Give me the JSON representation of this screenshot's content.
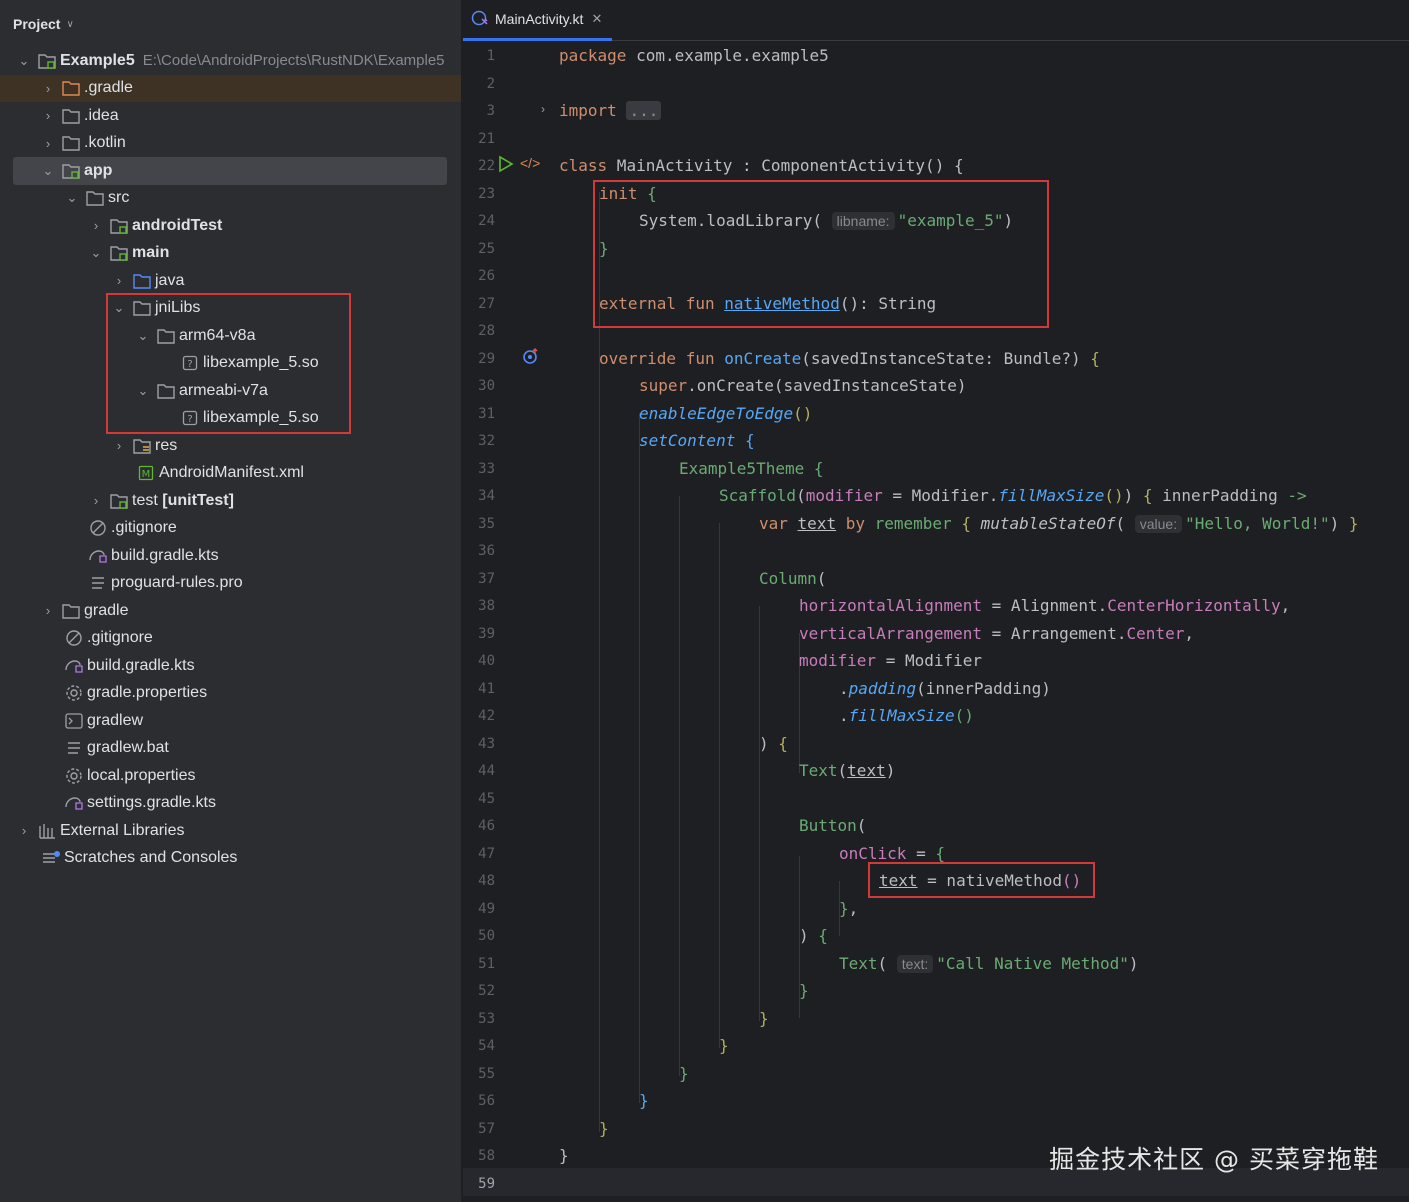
{
  "project_panel": {
    "title": "Project",
    "root": {
      "name": "Example5",
      "path": "E:\\Code\\AndroidProjects\\RustNDK\\Example5"
    },
    "items": [
      {
        "label": ".gradle"
      },
      {
        "label": ".idea"
      },
      {
        "label": ".kotlin"
      },
      {
        "label": "app"
      },
      {
        "label": "src"
      },
      {
        "label": "androidTest"
      },
      {
        "label": "main"
      },
      {
        "label": "java"
      },
      {
        "label": "jniLibs"
      },
      {
        "label": "arm64-v8a"
      },
      {
        "label": "libexample_5.so"
      },
      {
        "label": "armeabi-v7a"
      },
      {
        "label": "libexample_5.so"
      },
      {
        "label": "res"
      },
      {
        "label": "AndroidManifest.xml"
      },
      {
        "label": "test",
        "suffix": "[unitTest]"
      },
      {
        "label": ".gitignore"
      },
      {
        "label": "build.gradle.kts"
      },
      {
        "label": "proguard-rules.pro"
      },
      {
        "label": "gradle"
      },
      {
        "label": ".gitignore"
      },
      {
        "label": "build.gradle.kts"
      },
      {
        "label": "gradle.properties"
      },
      {
        "label": "gradlew"
      },
      {
        "label": "gradlew.bat"
      },
      {
        "label": "local.properties"
      },
      {
        "label": "settings.gradle.kts"
      },
      {
        "label": "External Libraries"
      },
      {
        "label": "Scratches and Consoles"
      }
    ]
  },
  "editor": {
    "tab_label": "MainActivity.kt",
    "line_numbers": [
      "1",
      "2",
      "3",
      "21",
      "22",
      "23",
      "24",
      "25",
      "26",
      "27",
      "28",
      "29",
      "30",
      "31",
      "32",
      "33",
      "34",
      "35",
      "36",
      "37",
      "38",
      "39",
      "40",
      "41",
      "42",
      "43",
      "44",
      "45",
      "46",
      "47",
      "48",
      "49",
      "50",
      "51",
      "52",
      "53",
      "54",
      "55",
      "56",
      "57",
      "58",
      "59"
    ],
    "hints": {
      "libname": "libname:",
      "value": "value:",
      "text": "text:"
    }
  },
  "watermark": "掘金技术社区 @ 买菜穿拖鞋",
  "colors": {
    "accent": "#3574f0",
    "highlight_box": "#d23a3a",
    "keyword": "#cf8e6d",
    "function": "#56a8f5",
    "string": "#6aab73"
  }
}
